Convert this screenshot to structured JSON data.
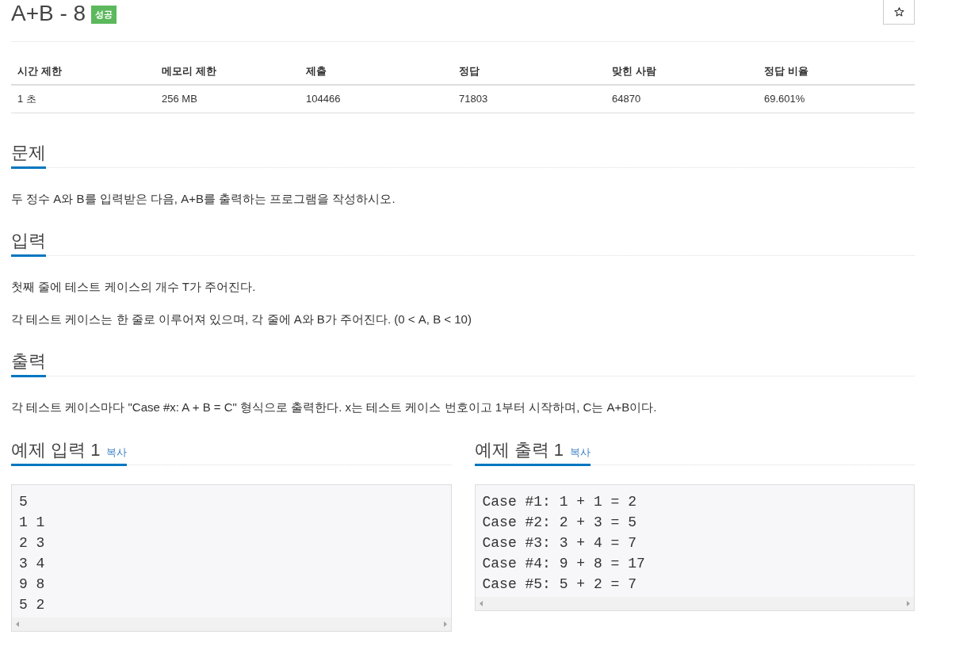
{
  "problem": {
    "title": "A+B - 8",
    "result_badge": {
      "label": "성공",
      "kind": "success"
    }
  },
  "stats_table": {
    "columns": [
      "시간 제한",
      "메모리 제한",
      "제출",
      "정답",
      "맞힌 사람",
      "정답 비율"
    ],
    "rows": [
      [
        "1 초",
        "256 MB",
        "104466",
        "71803",
        "64870",
        "69.601%"
      ]
    ]
  },
  "sections": [
    {
      "heading": "문제",
      "paragraphs": [
        "두 정수 A와 B를 입력받은 다음, A+B를 출력하는 프로그램을 작성하시오."
      ]
    },
    {
      "heading": "입력",
      "paragraphs": [
        "첫째 줄에 테스트 케이스의 개수 T가 주어진다.",
        "각 테스트 케이스는 한 줄로 이루어져 있으며, 각 줄에 A와 B가 주어진다. (0 < A, B < 10)"
      ]
    },
    {
      "heading": "출력",
      "paragraphs": [
        "각 테스트 케이스마다 \"Case #x: A + B = C\" 형식으로 출력한다. x는 테스트 케이스 번호이고 1부터 시작하며, C는 A+B이다."
      ]
    }
  ],
  "samples": [
    {
      "heading": "예제 입력 1",
      "copy_link": "복사",
      "lines": [
        "5",
        "1 1",
        "2 3",
        "3 4",
        "9 8",
        "5 2"
      ]
    },
    {
      "heading": "예제 출력 1",
      "copy_link": "복사",
      "lines": [
        "Case #1: 1 + 1 = 2",
        "Case #2: 2 + 3 = 5",
        "Case #3: 3 + 4 = 7",
        "Case #4: 9 + 8 = 17",
        "Case #5: 5 + 2 = 7"
      ]
    }
  ]
}
